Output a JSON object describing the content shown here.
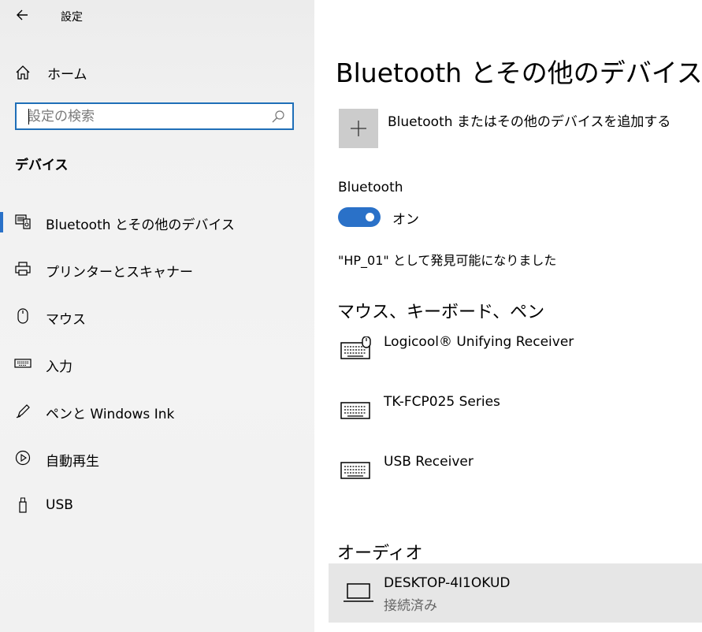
{
  "app": {
    "title": "設定"
  },
  "sidebar": {
    "home_label": "ホーム",
    "search_placeholder": "設定の検索",
    "section_title": "デバイス",
    "items": [
      {
        "label": "Bluetooth とその他のデバイス",
        "icon": "bluetooth-devices-icon",
        "active": true
      },
      {
        "label": "プリンターとスキャナー",
        "icon": "printer-icon"
      },
      {
        "label": "マウス",
        "icon": "mouse-icon"
      },
      {
        "label": "入力",
        "icon": "keyboard-icon"
      },
      {
        "label": "ペンと Windows Ink",
        "icon": "pen-icon"
      },
      {
        "label": "自動再生",
        "icon": "autoplay-icon"
      },
      {
        "label": "USB",
        "icon": "usb-icon"
      }
    ]
  },
  "main": {
    "title": "Bluetooth とその他のデバイス",
    "add_device_label": "Bluetooth またはその他のデバイスを追加する",
    "bluetooth_label": "Bluetooth",
    "toggle_state": "オン",
    "discoverable_text": "\"HP_01\" として発見可能になりました",
    "groups": [
      {
        "title": "マウス、キーボード、ペン",
        "devices": [
          {
            "name": "Logicool® Unifying Receiver",
            "icon": "keyboard-mouse-icon"
          },
          {
            "name": "TK-FCP025 Series",
            "icon": "keyboard-icon"
          },
          {
            "name": "USB Receiver",
            "icon": "keyboard-icon"
          }
        ]
      },
      {
        "title": "オーディオ",
        "devices": [
          {
            "name": "DESKTOP-4I1OKUD",
            "status": "接続済み",
            "icon": "laptop-icon"
          }
        ]
      }
    ]
  },
  "colors": {
    "accent": "#2a71c8",
    "search_border": "#1f6fb8",
    "selected_row": "#e6e6e6"
  }
}
